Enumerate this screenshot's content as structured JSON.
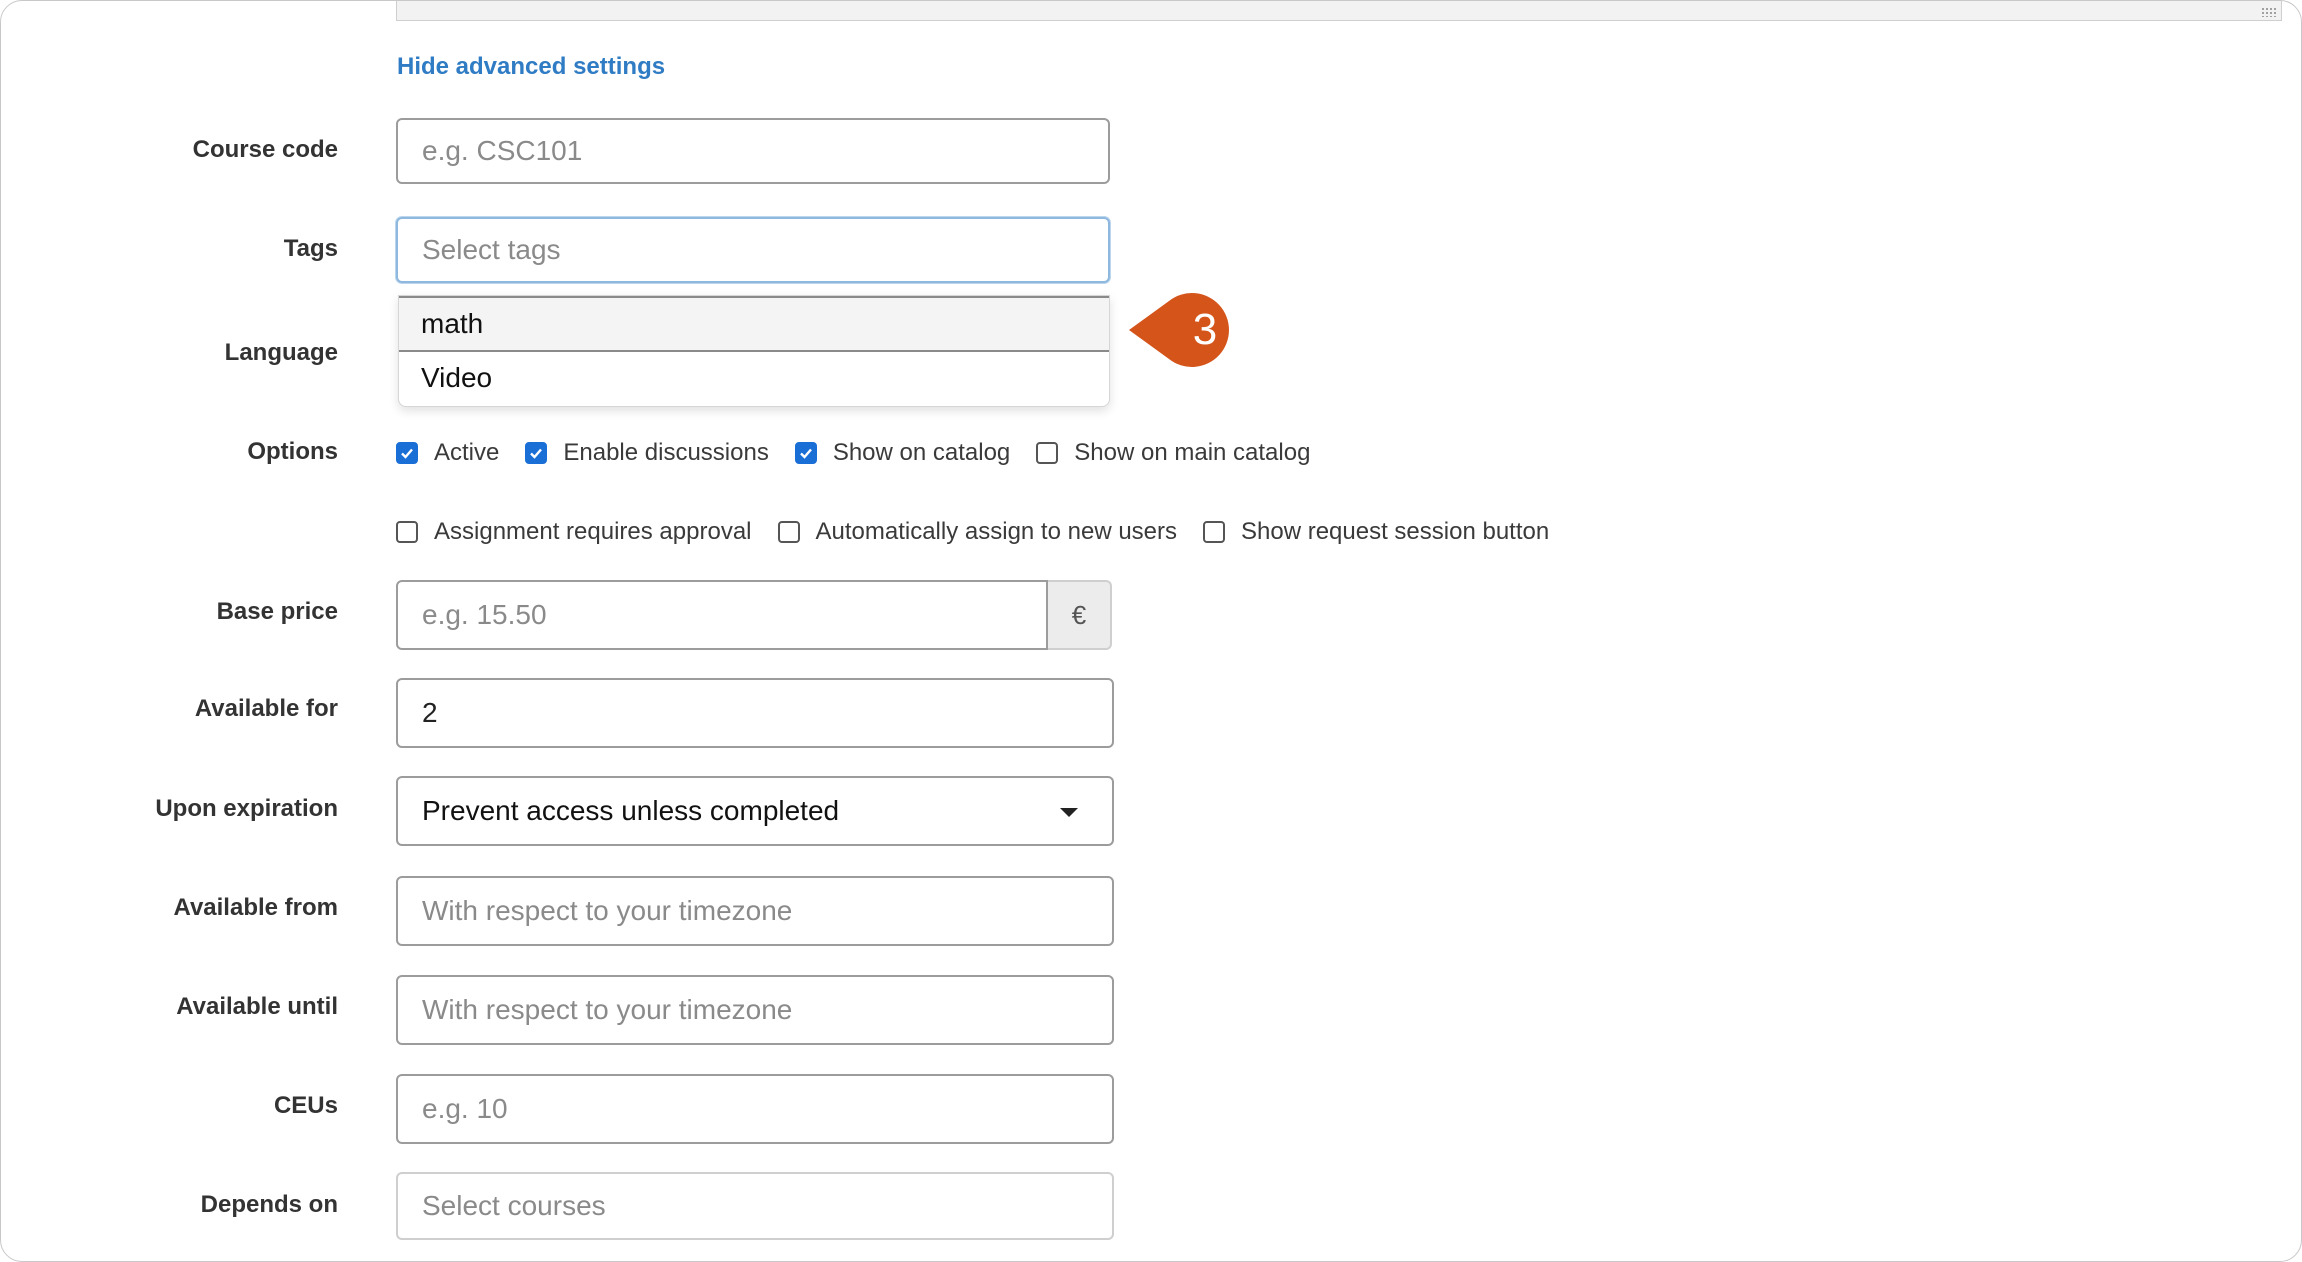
{
  "advanced": {
    "toggle_label": "Hide advanced settings"
  },
  "course_code": {
    "label": "Course code",
    "placeholder": "e.g. CSC101"
  },
  "tags": {
    "label": "Tags",
    "placeholder": "Select tags",
    "options": [
      "math",
      "Video"
    ]
  },
  "language": {
    "label": "Language"
  },
  "callout": {
    "number": "3",
    "color": "#d4541a"
  },
  "options": {
    "label": "Options",
    "row1": [
      {
        "label": "Active",
        "checked": true
      },
      {
        "label": "Enable discussions",
        "checked": true
      },
      {
        "label": "Show on catalog",
        "checked": true
      },
      {
        "label": "Show on main catalog",
        "checked": false
      }
    ],
    "row2": [
      {
        "label": "Assignment requires approval",
        "checked": false
      },
      {
        "label": "Automatically assign to new users",
        "checked": false
      },
      {
        "label": "Show request session button",
        "checked": false
      }
    ]
  },
  "base_price": {
    "label": "Base price",
    "placeholder": "e.g. 15.50",
    "currency": "€"
  },
  "available_for": {
    "label": "Available for",
    "value": "2"
  },
  "upon_expiration": {
    "label": "Upon expiration",
    "selected": "Prevent access unless completed"
  },
  "available_from": {
    "label": "Available from",
    "placeholder": "With respect to your timezone"
  },
  "available_until": {
    "label": "Available until",
    "placeholder": "With respect to your timezone"
  },
  "ceus": {
    "label": "CEUs",
    "placeholder": "e.g. 10"
  },
  "depends_on": {
    "label": "Depends on",
    "placeholder": "Select courses"
  },
  "colors": {
    "accent": "#1a6fd6",
    "link": "#2f7cc4",
    "callout": "#d4541a"
  }
}
